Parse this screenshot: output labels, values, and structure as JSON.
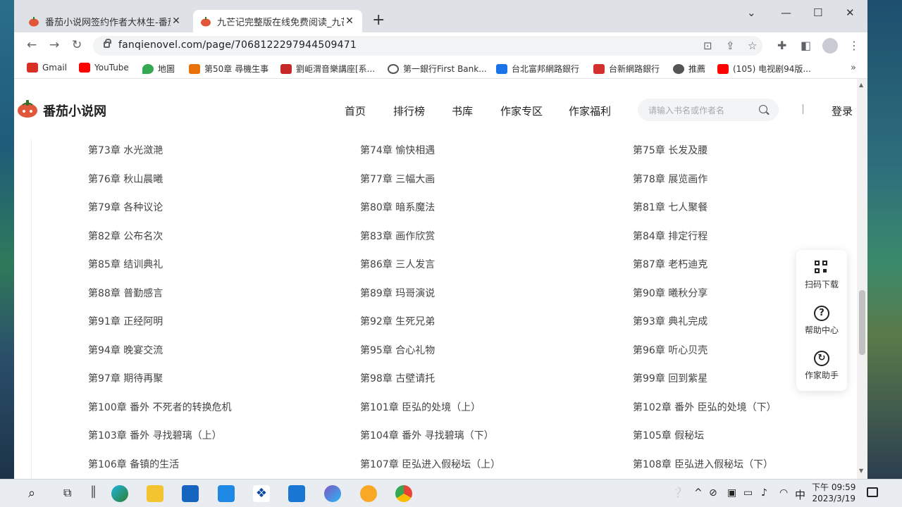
{
  "browser": {
    "tabs": [
      {
        "title": "番茄小说网签约作者大林生-番茄",
        "active": false
      },
      {
        "title": "九芒记完整版在线免费阅读_九芒",
        "active": true
      }
    ],
    "url": "fanqienovel.com/page/7068122297944509471",
    "bookmarks": [
      {
        "label": "Gmail",
        "color": "#d93025"
      },
      {
        "label": "YouTube",
        "color": "#ff0000"
      },
      {
        "label": "地圖",
        "color": "#34a853"
      },
      {
        "label": "第50章 尋機生事",
        "color": "#e8710a"
      },
      {
        "label": "劉岠渭音樂講座[系...",
        "color": "#c62828"
      },
      {
        "label": "第一銀行First Bank...",
        "color": "#555555"
      },
      {
        "label": "台北富邦網路銀行",
        "color": "#1a73e8"
      },
      {
        "label": "台新網路銀行",
        "color": "#d32f2f"
      },
      {
        "label": "推薦",
        "color": "#555555"
      },
      {
        "label": "(105) 电视剧94版...",
        "color": "#ff0000"
      }
    ]
  },
  "site": {
    "logo_text": "番茄小说网",
    "nav": [
      "首页",
      "排行榜",
      "书库",
      "作家专区",
      "作家福利"
    ],
    "search_placeholder": "请输入书名或作者名",
    "login": "登录"
  },
  "chapters": [
    "第73章 水光潋滟",
    "第74章 愉快相遇",
    "第75章 长发及腰",
    "第76章 秋山晨曦",
    "第77章 三幅大画",
    "第78章 展览画作",
    "第79章 各种议论",
    "第80章 暗系魔法",
    "第81章 七人聚餐",
    "第82章 公布名次",
    "第83章 画作欣赏",
    "第84章 排定行程",
    "第85章 结训典礼",
    "第86章 三人发言",
    "第87章 老朽迪克",
    "第88章 普勤感言",
    "第89章 玛哥演说",
    "第90章 曦秋分享",
    "第91章 正经阿明",
    "第92章 生死兄弟",
    "第93章 典礼完成",
    "第94章 晚宴交流",
    "第95章 合心礼物",
    "第96章 听心贝壳",
    "第97章 期待再聚",
    "第98章 古壁请托",
    "第99章 回到紫星",
    "第100章 番外 不死者的转换危机",
    "第101章 臣弘的处境（上）",
    "第102章 番外 臣弘的处境（下）",
    "第103章 番外 寻找碧璃（上）",
    "第104章 番外 寻找碧璃（下）",
    "第105章 假秘坛",
    "第106章 备镇的生活",
    "第107章 臣弘进入假秘坛（上）",
    "第108章 臣弘进入假秘坛（下）"
  ],
  "float_panel": {
    "items": [
      {
        "label": "扫码下载",
        "icon": "qr-code-icon"
      },
      {
        "label": "帮助中心",
        "icon": "help-icon"
      },
      {
        "label": "作家助手",
        "icon": "writer-assistant-icon"
      }
    ]
  },
  "taskbar": {
    "time": "下午 09:59",
    "date": "2023/3/19",
    "ime": "中"
  }
}
